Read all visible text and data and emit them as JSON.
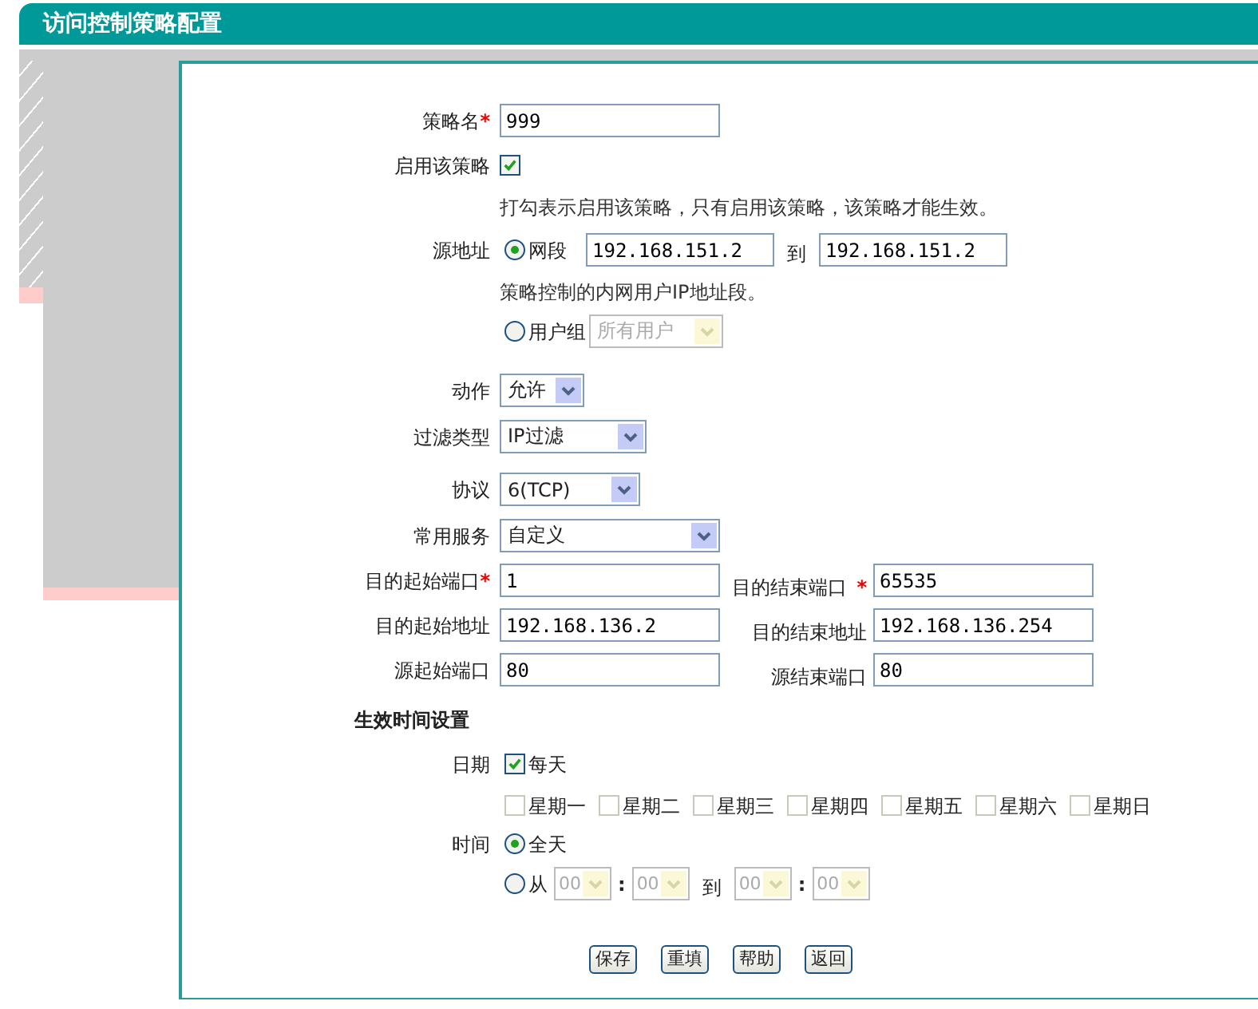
{
  "title": "访问控制策略配置",
  "policy_name": {
    "label": "策略名",
    "mark": "*",
    "value": "999"
  },
  "enable": {
    "label": "启用该策略",
    "checked": true,
    "hint": "打勾表示启用该策略，只有启用该策略，该策略才能生效。"
  },
  "source": {
    "label": "源地址",
    "options": [
      {
        "kind": "range",
        "label": "网段",
        "selected": true,
        "from": "192.168.151.2",
        "to_label": "到",
        "to": "192.168.151.2",
        "hint": "策略控制的内网用户IP地址段。"
      },
      {
        "kind": "group",
        "label": "用户组",
        "selected": false,
        "select": {
          "value": "所有用户",
          "disabled": true
        }
      }
    ]
  },
  "selects": [
    {
      "label": "动作",
      "value": "允许"
    },
    {
      "label": "过滤类型",
      "value": "IP过滤"
    },
    {
      "label": "协议",
      "value": "6(TCP)"
    },
    {
      "label": "常用服务",
      "value": "自定义"
    }
  ],
  "port_rows": [
    {
      "left": {
        "label": "目的起始端口",
        "mark": "*",
        "value": "1"
      },
      "right": {
        "label": "目的结束端口",
        "mark": "*",
        "value": "65535"
      }
    },
    {
      "left": {
        "label": "目的起始地址",
        "value": "192.168.136.2"
      },
      "right": {
        "label": "目的结束地址",
        "value": "192.168.136.254"
      }
    },
    {
      "left": {
        "label": "源起始端口",
        "value": "80"
      },
      "right": {
        "label": "源结束端口",
        "value": "80"
      }
    }
  ],
  "time_section": {
    "heading": "生效时间设置",
    "date": {
      "label": "日期",
      "everyday": {
        "label": "每天",
        "checked": true
      },
      "weekdays": [
        {
          "label": "星期一",
          "checked": false,
          "disabled": true
        },
        {
          "label": "星期二",
          "checked": false,
          "disabled": true
        },
        {
          "label": "星期三",
          "checked": false,
          "disabled": true
        },
        {
          "label": "星期四",
          "checked": false,
          "disabled": true
        },
        {
          "label": "星期五",
          "checked": false,
          "disabled": true
        },
        {
          "label": "星期六",
          "checked": false,
          "disabled": true
        },
        {
          "label": "星期日",
          "checked": false,
          "disabled": true
        }
      ]
    },
    "time": {
      "label": "时间",
      "options": [
        {
          "kind": "all",
          "label": "全天",
          "selected": true
        },
        {
          "kind": "range",
          "label": "从",
          "selected": false,
          "from_hour": {
            "value": "00",
            "disabled": true
          },
          "separator": ":",
          "from_minute": {
            "value": "00",
            "disabled": true
          },
          "to_label": "到",
          "to_hour": {
            "value": "00",
            "disabled": true
          },
          "to_minute": {
            "value": "00",
            "disabled": true
          }
        }
      ]
    }
  },
  "buttons": [
    "保存",
    "重填",
    "帮助",
    "返回"
  ]
}
